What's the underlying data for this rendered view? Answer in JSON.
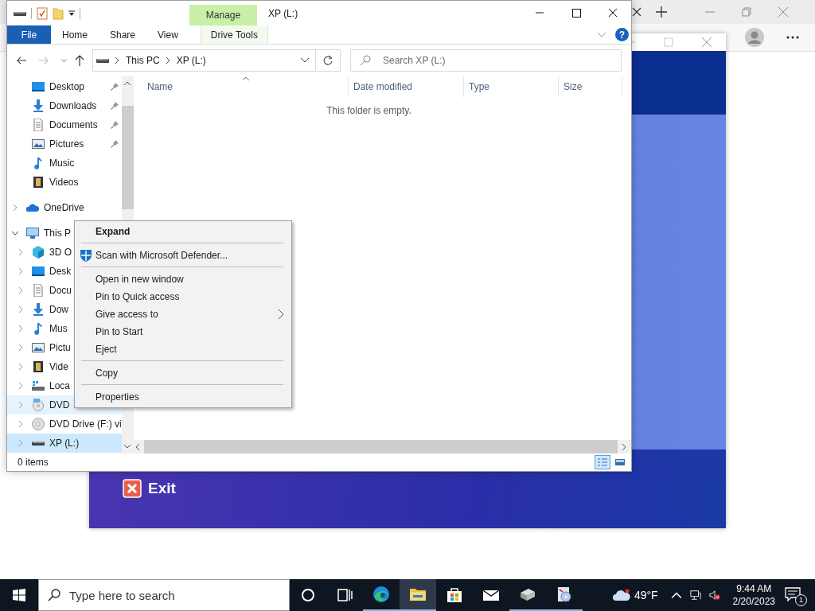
{
  "app_window": {
    "exit_button": {
      "label": "Exit"
    }
  },
  "explorer": {
    "title": "XP (L:)",
    "context_group": "Manage",
    "ribbon_tabs": [
      {
        "label": "File",
        "kind": "file"
      },
      {
        "label": "Home",
        "kind": "tab"
      },
      {
        "label": "Share",
        "kind": "tab"
      },
      {
        "label": "View",
        "kind": "tab"
      },
      {
        "label": "Drive Tools",
        "kind": "context"
      }
    ],
    "help": "?",
    "address": {
      "path": [
        "This PC",
        "XP (L:)"
      ]
    },
    "search": {
      "placeholder": "Search XP (L:)"
    },
    "nav": {
      "quick_access": [
        {
          "label": "Desktop",
          "kind": "desktop",
          "pinned": true
        },
        {
          "label": "Downloads",
          "kind": "downloads",
          "pinned": true
        },
        {
          "label": "Documents",
          "kind": "documents",
          "pinned": true
        },
        {
          "label": "Pictures",
          "kind": "pictures",
          "pinned": true
        },
        {
          "label": "Music",
          "kind": "music",
          "pinned": false
        },
        {
          "label": "Videos",
          "kind": "videos",
          "pinned": false
        }
      ],
      "tree": [
        {
          "label": "OneDrive",
          "kind": "onedrive",
          "expanded": false,
          "selected": false,
          "hover": false
        },
        {
          "label": "This P",
          "kind": "pc",
          "expanded": true,
          "selected": false,
          "hover": false,
          "children": [
            {
              "label": "3D O",
              "kind": "cube",
              "expanded": false,
              "selected": false,
              "hover": false
            },
            {
              "label": "Desk",
              "kind": "desktop",
              "expanded": false,
              "selected": false,
              "hover": false
            },
            {
              "label": "Docu",
              "kind": "documents",
              "expanded": false,
              "selected": false,
              "hover": false
            },
            {
              "label": "Dow",
              "kind": "downloads",
              "expanded": false,
              "selected": false,
              "hover": false
            },
            {
              "label": "Mus",
              "kind": "music",
              "expanded": false,
              "selected": false,
              "hover": false
            },
            {
              "label": "Pictu",
              "kind": "pictures",
              "expanded": false,
              "selected": false,
              "hover": false
            },
            {
              "label": "Vide",
              "kind": "videos",
              "expanded": false,
              "selected": false,
              "hover": false
            },
            {
              "label": "Loca",
              "kind": "local",
              "expanded": false,
              "selected": false,
              "hover": false
            },
            {
              "label": "DVD",
              "kind": "dvd",
              "expanded": false,
              "selected": false,
              "hover": true
            },
            {
              "label": "DVD Drive (F:) vi",
              "kind": "disc",
              "expanded": false,
              "selected": false,
              "hover": false
            },
            {
              "label": "XP (L:)",
              "kind": "drive",
              "expanded": false,
              "selected": true,
              "hover": false
            }
          ]
        }
      ]
    },
    "columns": [
      {
        "label": "Name",
        "sorted": true
      },
      {
        "label": "Date modified",
        "sorted": false
      },
      {
        "label": "Type",
        "sorted": false
      },
      {
        "label": "Size",
        "sorted": false
      }
    ],
    "empty_message": "This folder is empty.",
    "status": "0 items",
    "views": [
      {
        "kind": "details",
        "selected": true
      },
      {
        "kind": "tiles",
        "selected": false
      }
    ]
  },
  "context_menu": [
    {
      "label": "Expand",
      "kind": "default"
    },
    {
      "kind": "separator"
    },
    {
      "label": "Scan with Microsoft Defender...",
      "kind": "shield"
    },
    {
      "kind": "separator"
    },
    {
      "label": "Open in new window",
      "kind": "item"
    },
    {
      "label": "Pin to Quick access",
      "kind": "item"
    },
    {
      "label": "Give access to",
      "kind": "submenu"
    },
    {
      "label": "Pin to Start",
      "kind": "item"
    },
    {
      "label": "Eject",
      "kind": "item"
    },
    {
      "kind": "separator"
    },
    {
      "label": "Copy",
      "kind": "item"
    },
    {
      "kind": "separator"
    },
    {
      "label": "Properties",
      "kind": "item"
    }
  ],
  "taskbar": {
    "search": {
      "placeholder": "Type here to search"
    },
    "buttons": [
      {
        "kind": "cortana",
        "running": false,
        "active": false
      },
      {
        "kind": "task-view",
        "running": false,
        "active": false
      },
      {
        "kind": "edge",
        "running": true,
        "active": false
      },
      {
        "kind": "explorer",
        "running": true,
        "active": true
      },
      {
        "kind": "store",
        "running": false,
        "active": false
      },
      {
        "kind": "mail",
        "running": false,
        "active": false
      },
      {
        "kind": "drive-app",
        "running": true,
        "active": false
      },
      {
        "kind": "disc-app",
        "running": true,
        "active": false
      }
    ],
    "temperature": "49°F",
    "time": "9:44 AM",
    "date": "2/20/2023",
    "notifications": "1"
  }
}
